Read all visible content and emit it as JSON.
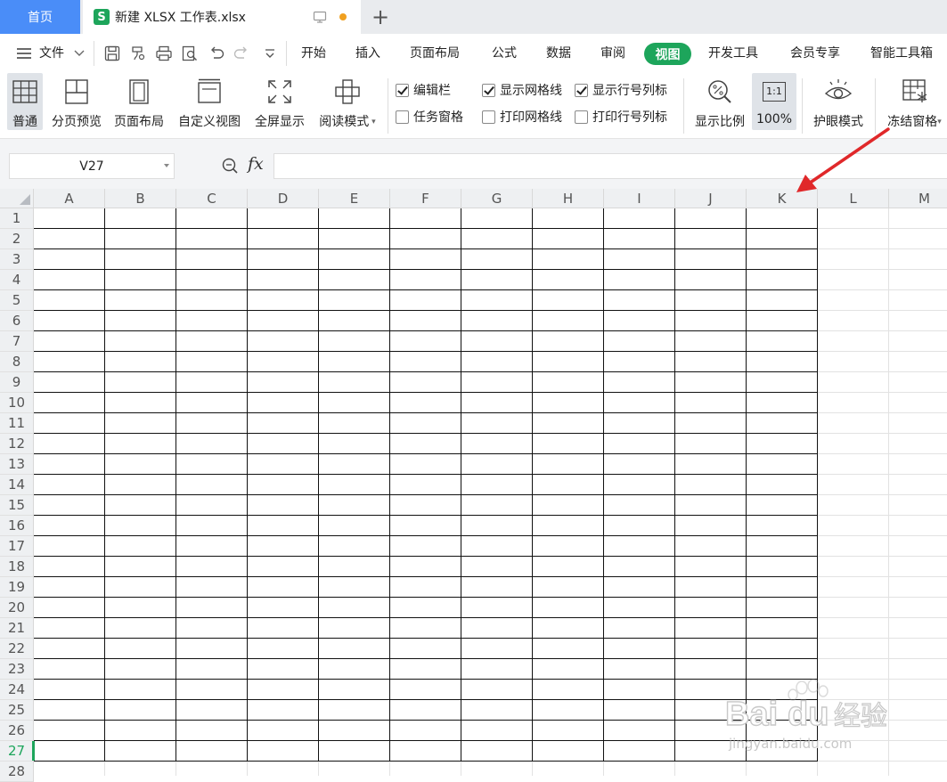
{
  "tabs": {
    "home": "首页",
    "file_icon": "S",
    "file_name": "新建 XLSX 工作表.xlsx",
    "new_tab": "+"
  },
  "menu": {
    "file": "文件",
    "items": [
      "开始",
      "插入",
      "页面布局",
      "公式",
      "数据",
      "审阅",
      "视图",
      "开发工具",
      "会员专享",
      "智能工具箱"
    ],
    "active": "视图"
  },
  "ribbon": {
    "normal": "普通",
    "page_break_preview": "分页预览",
    "page_layout": "页面布局",
    "custom_view": "自定义视图",
    "full_screen": "全屏显示",
    "reading_mode": "阅读模式",
    "checkboxes": {
      "formula_bar": {
        "label": "编辑栏",
        "checked": true
      },
      "task_pane": {
        "label": "任务窗格",
        "checked": false
      },
      "show_gridlines": {
        "label": "显示网格线",
        "checked": true
      },
      "print_gridlines": {
        "label": "打印网格线",
        "checked": false
      },
      "show_headings": {
        "label": "显示行号列标",
        "checked": true
      },
      "print_headings": {
        "label": "打印行号列标",
        "checked": false
      }
    },
    "zoom": "显示比例",
    "zoom_100": "100%",
    "zoom_100_icon": "1:1",
    "eye_protection": "护眼模式",
    "freeze_panes": "冻结窗格"
  },
  "formula_bar": {
    "name_box": "V27",
    "fx": "fx",
    "formula": ""
  },
  "grid": {
    "columns": [
      "A",
      "B",
      "C",
      "D",
      "E",
      "F",
      "G",
      "H",
      "I",
      "J",
      "K",
      "L",
      "M"
    ],
    "rows": [
      "1",
      "2",
      "3",
      "4",
      "5",
      "6",
      "7",
      "8",
      "9",
      "10",
      "11",
      "12",
      "13",
      "14",
      "15",
      "16",
      "17",
      "18",
      "19",
      "20",
      "21",
      "22",
      "23",
      "24",
      "25",
      "26",
      "27",
      "28"
    ],
    "selected_row": "27",
    "bordered_columns": 11,
    "bordered_rows": 27
  },
  "colors": {
    "accent": "#1da55b",
    "home_tab": "#4a8df8",
    "arrow": "#e0282a"
  },
  "watermark": {
    "brand": "Bai",
    "brand2": "du",
    "suffix": "经验",
    "url": "jingyan.baidu.com"
  }
}
